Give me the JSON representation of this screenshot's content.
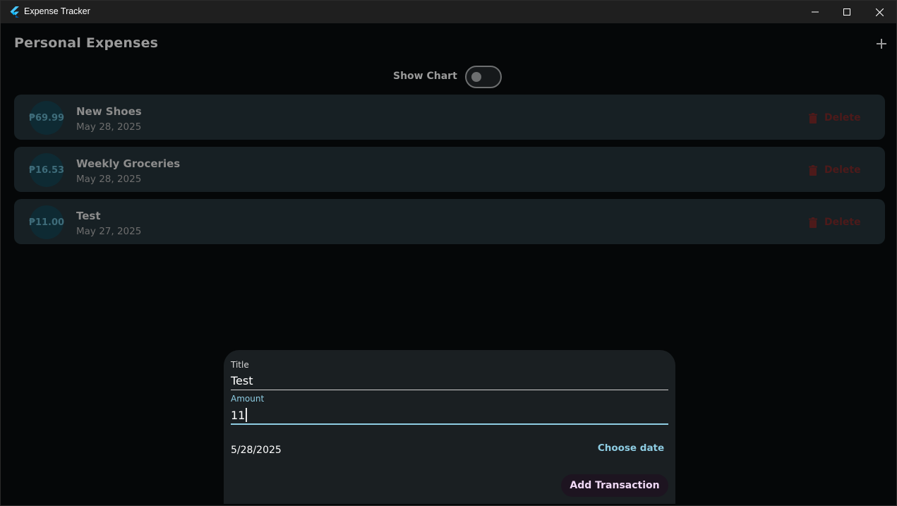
{
  "window": {
    "title": "Expense Tracker",
    "controls": [
      "minimize-icon",
      "maximize-icon",
      "close-icon"
    ]
  },
  "header": {
    "title": "Personal Expenses",
    "add_icon": "plus-icon"
  },
  "chart_toggle": {
    "label": "Show Chart",
    "state": "off"
  },
  "transactions": [
    {
      "amount": "₱69.99",
      "title": "New Shoes",
      "date": "May 28, 2025",
      "delete_label": "Delete"
    },
    {
      "amount": "₱16.53",
      "title": "Weekly Groceries",
      "date": "May 28, 2025",
      "delete_label": "Delete"
    },
    {
      "amount": "₱11.00",
      "title": "Test",
      "date": "May 27, 2025",
      "delete_label": "Delete"
    }
  ],
  "form": {
    "title_label": "Title",
    "title_value": "Test",
    "amount_label": "Amount",
    "amount_value": "11",
    "date_value": "5/28/2025",
    "choose_date_label": "Choose date",
    "submit_label": "Add Transaction"
  },
  "colors": {
    "accent": "#8ecde3",
    "delete": "#4d1a1a",
    "card_bg": "#172024",
    "submit_text": "#f0d9f5"
  }
}
